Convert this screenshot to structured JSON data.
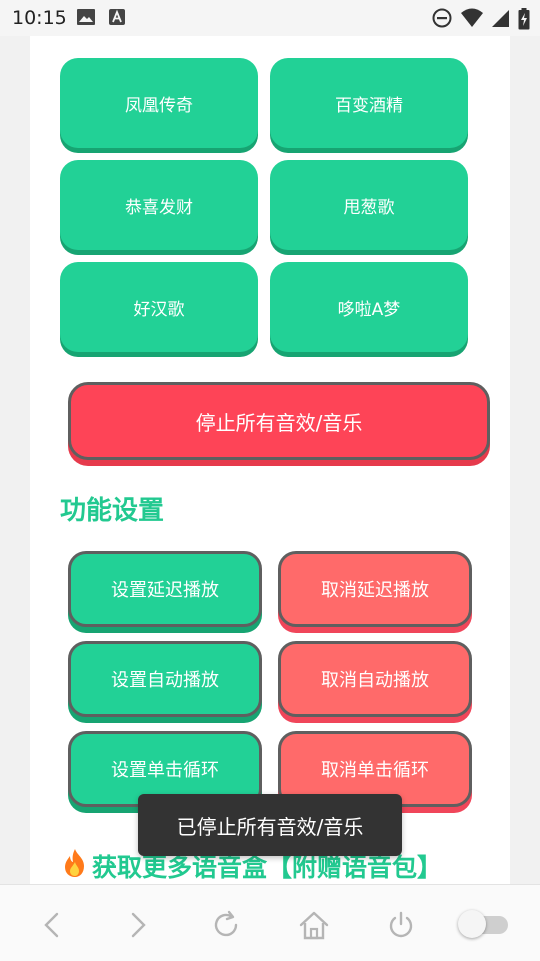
{
  "status_bar": {
    "time": "10:15",
    "icons": [
      "image-icon",
      "font-app-icon",
      "do-not-disturb-icon",
      "wifi-icon",
      "signal-icon",
      "battery-charging-icon"
    ]
  },
  "songs": [
    {
      "label": "凤凰传奇"
    },
    {
      "label": "百变酒精"
    },
    {
      "label": "恭喜发财"
    },
    {
      "label": "甩葱歌"
    },
    {
      "label": "好汉歌"
    },
    {
      "label": "哆啦A梦"
    }
  ],
  "stop_button": {
    "label": "停止所有音效/音乐"
  },
  "section": {
    "title": "功能设置"
  },
  "functions": [
    {
      "label": "设置延迟播放",
      "style": "green"
    },
    {
      "label": "取消延迟播放",
      "style": "red"
    },
    {
      "label": "设置自动播放",
      "style": "green"
    },
    {
      "label": "取消自动播放",
      "style": "red"
    },
    {
      "label": "设置单击循环",
      "style": "green"
    },
    {
      "label": "取消单击循环",
      "style": "red"
    }
  ],
  "promo": {
    "text": "获取更多语音盒【附赠语音包】",
    "icon": "fire-icon"
  },
  "toast": {
    "text": "已停止所有音效/音乐"
  },
  "toolbar": {
    "icons": [
      "back-arrow-icon",
      "forward-arrow-icon",
      "refresh-icon",
      "home-icon",
      "power-icon",
      "toggle-switch"
    ]
  },
  "colors": {
    "accent_green": "#22d196",
    "stop_red": "#fe4457",
    "cancel_red": "#ff6a6a",
    "title_green": "#22c990"
  }
}
